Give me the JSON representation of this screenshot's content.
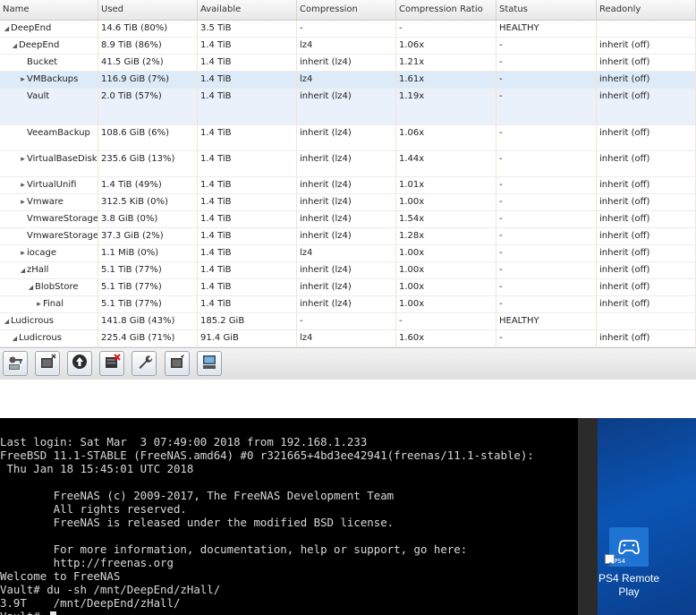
{
  "grid": {
    "columns": [
      "Name",
      "Used",
      "Available",
      "Compression",
      "Compression Ratio",
      "Status",
      "Readonly"
    ],
    "rows": [
      {
        "name": "DeepEnd",
        "indent": 0,
        "expander": "down",
        "used": "14.6 TiB (80%)",
        "available": "3.5 TiB",
        "compression": "-",
        "ratio": "-",
        "status": "HEALTHY",
        "readonly": "",
        "height": 19,
        "highlight": ""
      },
      {
        "name": "DeepEnd",
        "indent": 1,
        "expander": "down",
        "used": "8.9 TiB (86%)",
        "available": "1.4 TiB",
        "compression": "lz4",
        "ratio": "1.06x",
        "status": "-",
        "readonly": "inherit (off)",
        "height": 19,
        "highlight": ""
      },
      {
        "name": "Bucket",
        "indent": 2,
        "expander": "",
        "used": "41.5 GiB (2%)",
        "available": "1.4 TiB",
        "compression": "inherit (lz4)",
        "ratio": "1.21x",
        "status": "-",
        "readonly": "inherit (off)",
        "height": 19,
        "highlight": ""
      },
      {
        "name": "VMBackups",
        "indent": 2,
        "expander": "right",
        "used": "116.9 GiB (7%)",
        "available": "1.4 TiB",
        "compression": "lz4",
        "ratio": "1.61x",
        "status": "-",
        "readonly": "inherit (off)",
        "height": 19,
        "highlight": "sel"
      },
      {
        "name": "Vault",
        "indent": 2,
        "expander": "",
        "used": "2.0 TiB (57%)",
        "available": "1.4 TiB",
        "compression": "inherit (lz4)",
        "ratio": "1.19x",
        "status": "-",
        "readonly": "inherit (off)",
        "height": 41,
        "highlight": "sel2"
      },
      {
        "name": "VeeamBackup",
        "indent": 2,
        "expander": "",
        "used": "108.6 GiB (6%)",
        "available": "1.4 TiB",
        "compression": "inherit (lz4)",
        "ratio": "1.06x",
        "status": "-",
        "readonly": "inherit (off)",
        "height": 29,
        "highlight": ""
      },
      {
        "name": "VirtualBaseDisk",
        "indent": 2,
        "expander": "right",
        "used": "235.6 GiB (13%)",
        "available": "1.4 TiB",
        "compression": "inherit (lz4)",
        "ratio": "1.44x",
        "status": "-",
        "readonly": "inherit (off)",
        "height": 29,
        "highlight": ""
      },
      {
        "name": "VirtualUnifi",
        "indent": 2,
        "expander": "right",
        "used": "1.4 TiB (49%)",
        "available": "1.4 TiB",
        "compression": "inherit (lz4)",
        "ratio": "1.01x",
        "status": "-",
        "readonly": "inherit (off)",
        "height": 19,
        "highlight": ""
      },
      {
        "name": "Vmware",
        "indent": 2,
        "expander": "right",
        "used": "312.5 KiB (0%)",
        "available": "1.4 TiB",
        "compression": "inherit (lz4)",
        "ratio": "1.00x",
        "status": "-",
        "readonly": "inherit (off)",
        "height": 19,
        "highlight": ""
      },
      {
        "name": "VmwareStorage",
        "indent": 2,
        "expander": "",
        "used": "3.8 GiB (0%)",
        "available": "1.4 TiB",
        "compression": "inherit (lz4)",
        "ratio": "1.54x",
        "status": "-",
        "readonly": "inherit (off)",
        "height": 19,
        "highlight": ""
      },
      {
        "name": "VmwareStorage",
        "indent": 2,
        "expander": "",
        "used": "37.3 GiB (2%)",
        "available": "1.4 TiB",
        "compression": "inherit (lz4)",
        "ratio": "1.28x",
        "status": "-",
        "readonly": "inherit (off)",
        "height": 19,
        "highlight": ""
      },
      {
        "name": "iocage",
        "indent": 2,
        "expander": "right",
        "used": "1.1 MiB (0%)",
        "available": "1.4 TiB",
        "compression": "lz4",
        "ratio": "1.00x",
        "status": "-",
        "readonly": "inherit (off)",
        "height": 19,
        "highlight": ""
      },
      {
        "name": "zHall",
        "indent": 2,
        "expander": "down",
        "used": "5.1 TiB (77%)",
        "available": "1.4 TiB",
        "compression": "inherit (lz4)",
        "ratio": "1.00x",
        "status": "-",
        "readonly": "inherit (off)",
        "height": 19,
        "highlight": ""
      },
      {
        "name": "BlobStore",
        "indent": 3,
        "expander": "down",
        "used": "5.1 TiB (77%)",
        "available": "1.4 TiB",
        "compression": "inherit (lz4)",
        "ratio": "1.00x",
        "status": "-",
        "readonly": "inherit (off)",
        "height": 19,
        "highlight": ""
      },
      {
        "name": "Final",
        "indent": 4,
        "expander": "right",
        "used": "5.1 TiB (77%)",
        "available": "1.4 TiB",
        "compression": "inherit (lz4)",
        "ratio": "1.00x",
        "status": "-",
        "readonly": "inherit (off)",
        "height": 19,
        "highlight": ""
      },
      {
        "name": "Ludicrous",
        "indent": 0,
        "expander": "down",
        "used": "141.8 GiB (43%)",
        "available": "185.2 GiB",
        "compression": "-",
        "ratio": "-",
        "status": "HEALTHY",
        "readonly": "",
        "height": 19,
        "highlight": ""
      },
      {
        "name": "Ludicrous",
        "indent": 1,
        "expander": "down",
        "used": "225.4 GiB (71%)",
        "available": "91.4 GiB",
        "compression": "lz4",
        "ratio": "1.60x",
        "status": "-",
        "readonly": "inherit (off)",
        "height": 19,
        "highlight": ""
      }
    ]
  },
  "toolbar": {
    "buttons": [
      {
        "icon": "key-icon"
      },
      {
        "icon": "add-dataset-icon"
      },
      {
        "icon": "upload-icon"
      },
      {
        "icon": "delete-dataset-icon"
      },
      {
        "icon": "wrench-icon"
      },
      {
        "icon": "edit-dataset-icon"
      },
      {
        "icon": "snapshot-icon"
      }
    ]
  },
  "terminal": {
    "lines": [
      "Last login: Sat Mar  3 07:49:00 2018 from 192.168.1.233",
      "FreeBSD 11.1-STABLE (FreeNAS.amd64) #0 r321665+4bd3ee42941(freenas/11.1-stable):",
      " Thu Jan 18 15:45:01 UTC 2018",
      "",
      "        FreeNAS (c) 2009-2017, The FreeNAS Development Team",
      "        All rights reserved.",
      "        FreeNAS is released under the modified BSD license.",
      "",
      "        For more information, documentation, help or support, go here:",
      "        http://freenas.org",
      "Welcome to FreeNAS",
      "Vault# du -sh /mnt/DeepEnd/zHall/",
      "3.9T    /mnt/DeepEnd/zHall/",
      "Vault# "
    ]
  },
  "desktop": {
    "icon_badge": "PS4",
    "icon_label": "PS4 Remote Play"
  },
  "colors": {
    "selected_row": "#ddeaf7",
    "terminal_bg": "#000000",
    "desktop_bg": "#0a4fa8"
  }
}
